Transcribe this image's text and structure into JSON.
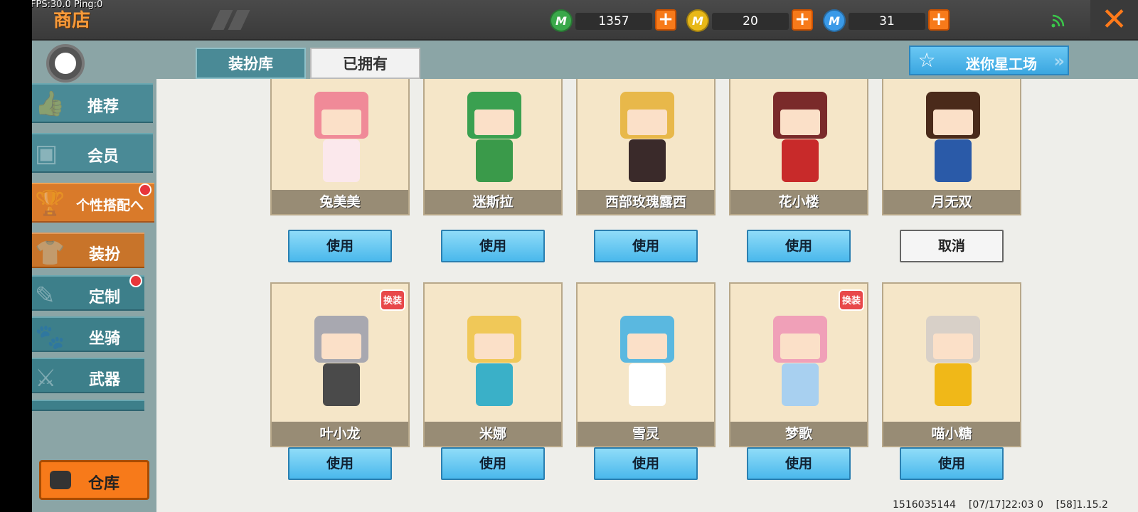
{
  "debug": {
    "fps_text": "FPS:30.0  Ping:0"
  },
  "header": {
    "title": "商店",
    "currencies": [
      {
        "icon": "green-gem-icon",
        "value": "1357",
        "color": "#3aa84a",
        "glyph": "M"
      },
      {
        "icon": "gold-coin-icon",
        "value": "20",
        "color": "#e8b818",
        "glyph": "M"
      },
      {
        "icon": "blue-star-coin-icon",
        "value": "31",
        "color": "#3a9ae8",
        "glyph": "M"
      }
    ],
    "plus_label": "+",
    "close_label": "✕"
  },
  "sidebar": {
    "items": [
      {
        "label": "推荐",
        "icon": "thumbs-up-icon"
      },
      {
        "label": "会员",
        "icon": "vip-card-icon"
      },
      {
        "label": "个性搭配へ",
        "icon": "trophy-icon"
      },
      {
        "label": "装扮",
        "icon": "shirt-icon"
      },
      {
        "label": "定制",
        "icon": "pencil-icon"
      },
      {
        "label": "坐骑",
        "icon": "mount-icon"
      },
      {
        "label": "武器",
        "icon": "gun-icon"
      }
    ],
    "warehouse_label": "仓库"
  },
  "tabs": {
    "costume_library": "装扮库",
    "owned": "已拥有",
    "workshop": "迷你星工场"
  },
  "colors": {
    "accent": "#f77a1a",
    "teal": "#4a8a96",
    "use_button": "#4ab8ec"
  },
  "cards": [
    {
      "name": "兔美美",
      "button": "使用",
      "hair": "#f08a98",
      "body": "#fbe8ec",
      "badge": ""
    },
    {
      "name": "迷斯拉",
      "button": "使用",
      "hair": "#3aa050",
      "body": "#3a9a4a",
      "badge": ""
    },
    {
      "name": "西部玫瑰露西",
      "button": "使用",
      "hair": "#e8b84a",
      "body": "#3a2a2a",
      "badge": ""
    },
    {
      "name": "花小楼",
      "button": "使用",
      "hair": "#7a2a2a",
      "body": "#c82a2a",
      "badge": ""
    },
    {
      "name": "月无双",
      "button": "取消",
      "hair": "#4a2a1a",
      "body": "#2a5aa8",
      "badge": ""
    },
    {
      "name": "叶小龙",
      "button": "使用",
      "hair": "#a8a8b0",
      "body": "#4a4a4a",
      "badge": "换装"
    },
    {
      "name": "米娜",
      "button": "使用",
      "hair": "#f0c858",
      "body": "#3ab0c8",
      "badge": ""
    },
    {
      "name": "雪灵",
      "button": "使用",
      "hair": "#5ab8e0",
      "body": "#ffffff",
      "badge": ""
    },
    {
      "name": "梦歌",
      "button": "使用",
      "hair": "#f0a0b8",
      "body": "#a8d0f0",
      "badge": "换装"
    },
    {
      "name": "喵小糖",
      "button": "使用",
      "hair": "#d8d0c8",
      "body": "#f0b818",
      "badge": ""
    }
  ],
  "footer": {
    "info": "1516035144    [07/17]22:03 0    [58]1.15.2"
  }
}
